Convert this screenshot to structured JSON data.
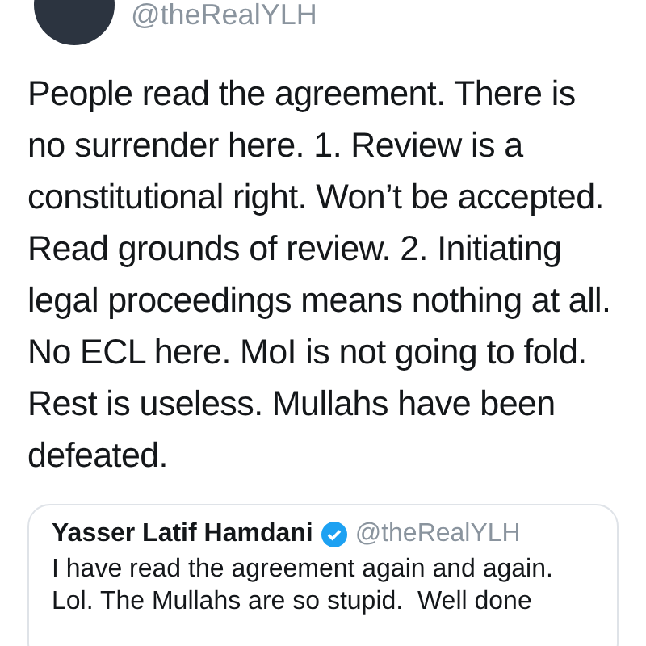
{
  "author": {
    "handle": "@theRealYLH"
  },
  "tweet": {
    "text": "People read the agreement. There is no surrender here. 1. Review is a constitutional right. Won’t be accepted. Read grounds of review. 2. Initiating legal proceedings means nothing at all. No ECL here. MoI is not going to fold. Rest is useless. Mullahs have been defeated."
  },
  "quoted_tweet": {
    "name": "Yasser Latif Hamdani",
    "verified": true,
    "handle": "@theRealYLH",
    "text": "I have read the agreement again and again. Lol. The Mullahs are so stupid.  Well done"
  }
}
